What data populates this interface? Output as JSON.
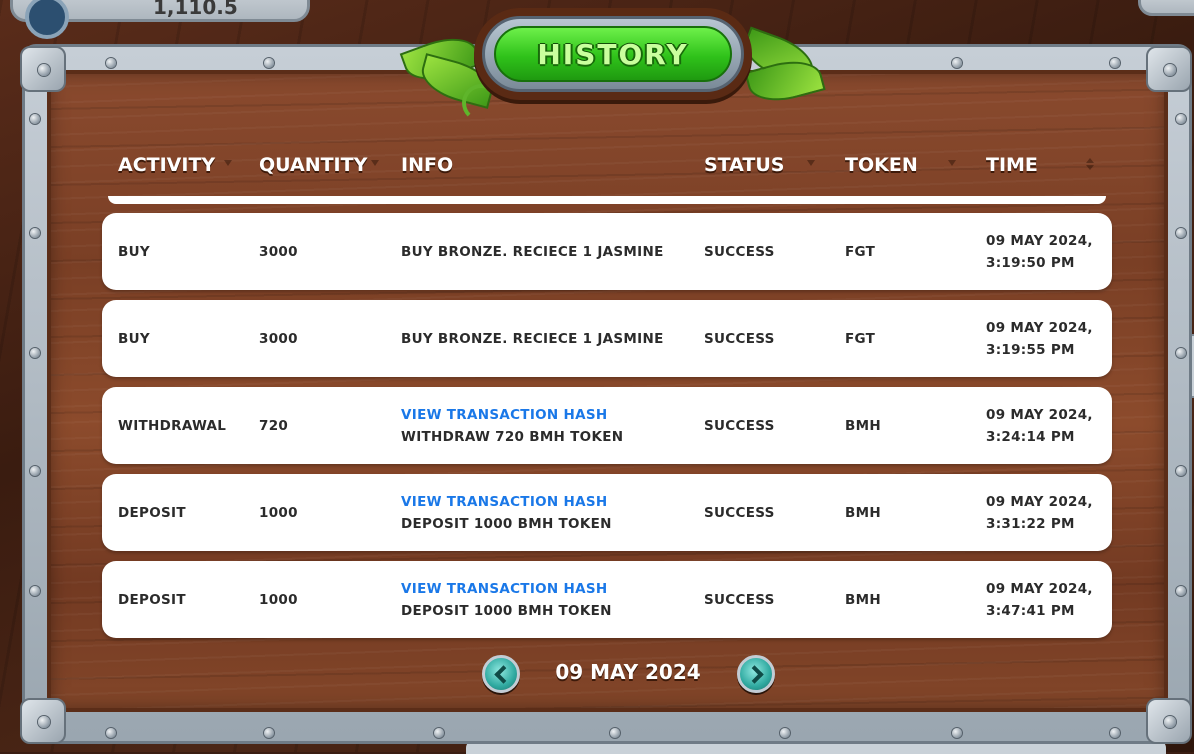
{
  "top_bar": {
    "balance": "1,110.5"
  },
  "title": "HISTORY",
  "table": {
    "columns": [
      "ACTIVITY",
      "QUANTITY",
      "INFO",
      "STATUS",
      "TOKEN",
      "TIME"
    ],
    "rows": [
      {
        "activity": "BUY",
        "quantity": "3000",
        "link": "",
        "info": "BUY BRONZE. RECIECE 1 JASMINE",
        "status": "SUCCESS",
        "token": "FGT",
        "date": "09 MAY 2024,",
        "time": "3:19:50 PM"
      },
      {
        "activity": "BUY",
        "quantity": "3000",
        "link": "",
        "info": "BUY BRONZE. RECIECE 1 JASMINE",
        "status": "SUCCESS",
        "token": "FGT",
        "date": "09 MAY 2024,",
        "time": "3:19:55 PM"
      },
      {
        "activity": "WITHDRAWAL",
        "quantity": "720",
        "link": "VIEW TRANSACTION HASH",
        "info": "WITHDRAW 720 BMH TOKEN",
        "status": "SUCCESS",
        "token": "BMH",
        "date": "09 MAY 2024,",
        "time": "3:24:14 PM"
      },
      {
        "activity": "DEPOSIT",
        "quantity": "1000",
        "link": "VIEW TRANSACTION HASH",
        "info": "DEPOSIT 1000 BMH TOKEN",
        "status": "SUCCESS",
        "token": "BMH",
        "date": "09 MAY 2024,",
        "time": "3:31:22 PM"
      },
      {
        "activity": "DEPOSIT",
        "quantity": "1000",
        "link": "VIEW TRANSACTION HASH",
        "info": "DEPOSIT 1000 BMH TOKEN",
        "status": "SUCCESS",
        "token": "BMH",
        "date": "09 MAY 2024,",
        "time": "3:47:41 PM"
      }
    ]
  },
  "pagination": {
    "current_date": "09 MAY 2024",
    "prev_icon": "chevron-left-icon",
    "next_icon": "chevron-right-icon"
  },
  "colors": {
    "accent_green": "#2fc21a",
    "link_blue": "#1a78e8",
    "wood": "#7a3f25",
    "pager_teal": "#2fa9a0"
  }
}
